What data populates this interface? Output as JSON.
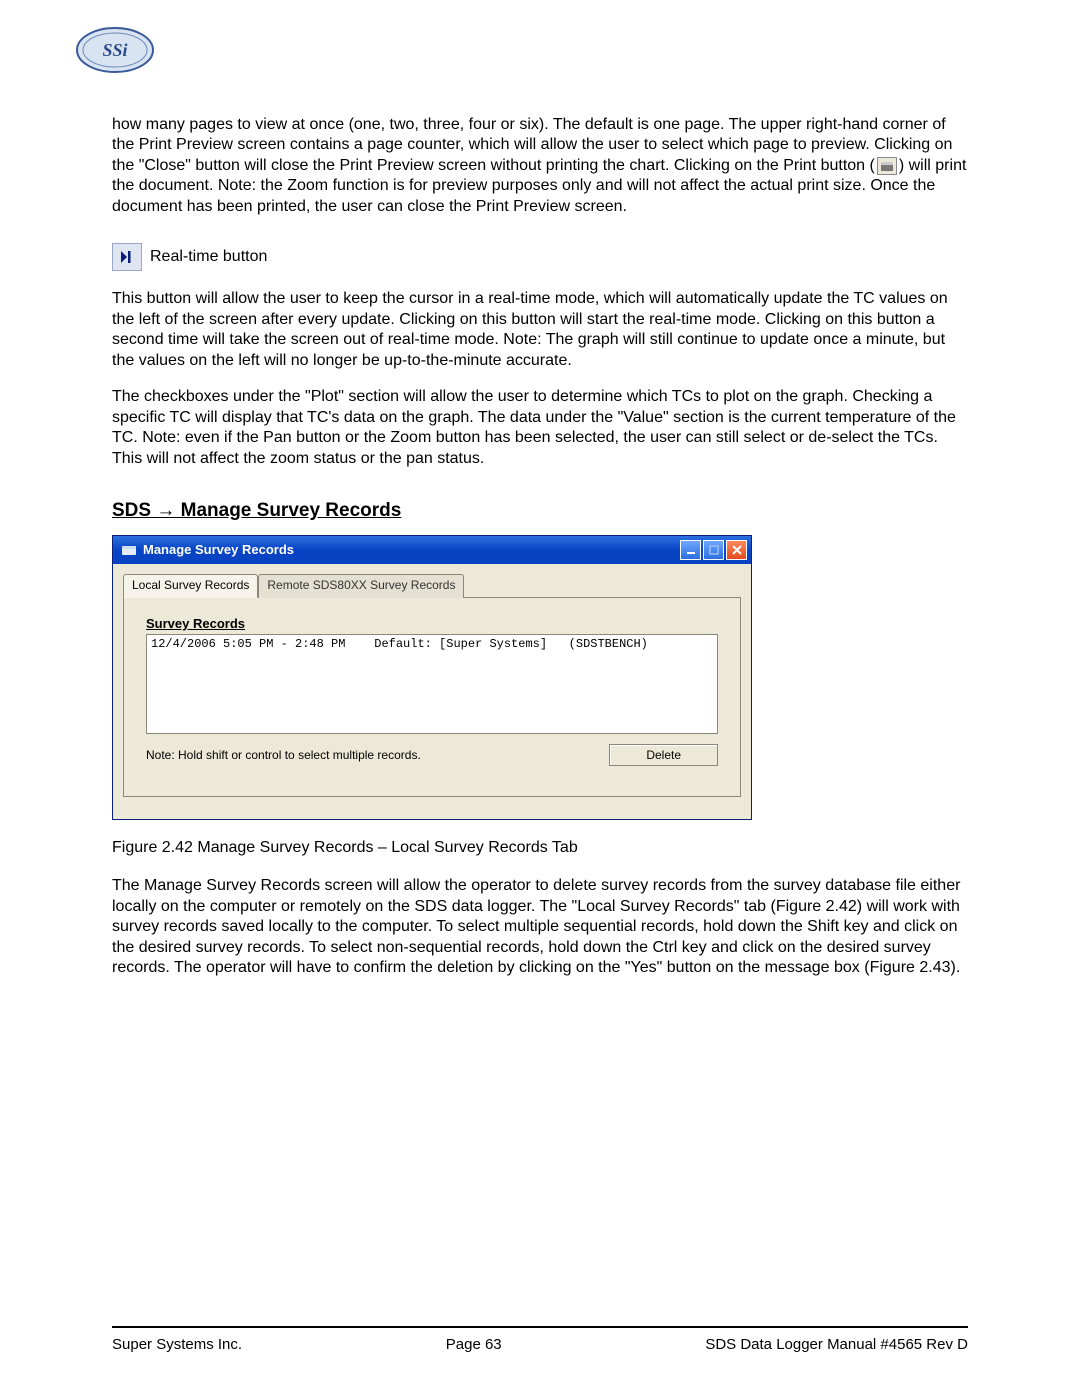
{
  "logo": {
    "alt": "SSi logo"
  },
  "paragraphs": {
    "p1_a": "how many pages to view at once (one, two, three, four or six).  The default is one page.  The upper right-hand corner of the Print Preview screen contains a page counter, which will allow the user to select which page to preview.  Clicking on the \"Close\" button will close the Print Preview screen without printing the chart.  Clicking on the Print button (",
    "p1_b": ") will print the document.  Note: the Zoom function is for preview purposes only and will not affect the actual print size.  Once the document has been printed, the user can close the Print Preview screen.",
    "realtime_label": " Real-time button",
    "p2": "This button will allow the user to keep the cursor in a real-time mode, which will automatically update the TC values on the left of the screen after every update.  Clicking on this button will start the real-time mode.  Clicking on this button a second time will take the screen out of real-time mode.  Note: The graph will still continue to update once a minute, but the values on the left will no longer be up-to-the-minute accurate.",
    "p3": "The checkboxes under the \"Plot\" section will allow the user to determine which TCs to plot on the graph.  Checking a specific TC will display that TC's data on the graph.  The data under the \"Value\" section is the current temperature of the TC.  Note: even if the Pan button or the Zoom button has been selected, the user can still select or de-select the TCs.  This will not affect the zoom status or the pan status."
  },
  "heading": "SDS → Manage Survey Records",
  "window": {
    "title": "Manage Survey Records",
    "tabs": {
      "active": "Local Survey Records",
      "inactive": "Remote SDS80XX Survey Records"
    },
    "records_label": "Survey Records",
    "record_row": "12/4/2006 5:05 PM - 2:48 PM    Default: [Super Systems]   (SDSTBENCH)",
    "note": "Note: Hold shift or control to select multiple records.",
    "delete_label": "Delete"
  },
  "caption": "Figure 2.42 Manage Survey Records – Local Survey Records Tab",
  "paragraphs2": {
    "p4": "The Manage Survey Records screen will allow the operator to delete survey records from the survey database file either locally on the computer or remotely on the SDS data logger.  The \"Local Survey Records\" tab (Figure 2.42) will work with survey records saved locally to the computer.  To select multiple sequential records, hold down the Shift key and click on the desired survey records.  To select non-sequential records, hold down the Ctrl key and click on the desired survey records.  The operator will have to confirm the deletion by clicking on the \"Yes\" button on the message box (Figure 2.43)."
  },
  "footer": {
    "left": "Super Systems Inc.",
    "center": "Page 63",
    "right": "SDS Data Logger Manual #4565 Rev D"
  }
}
